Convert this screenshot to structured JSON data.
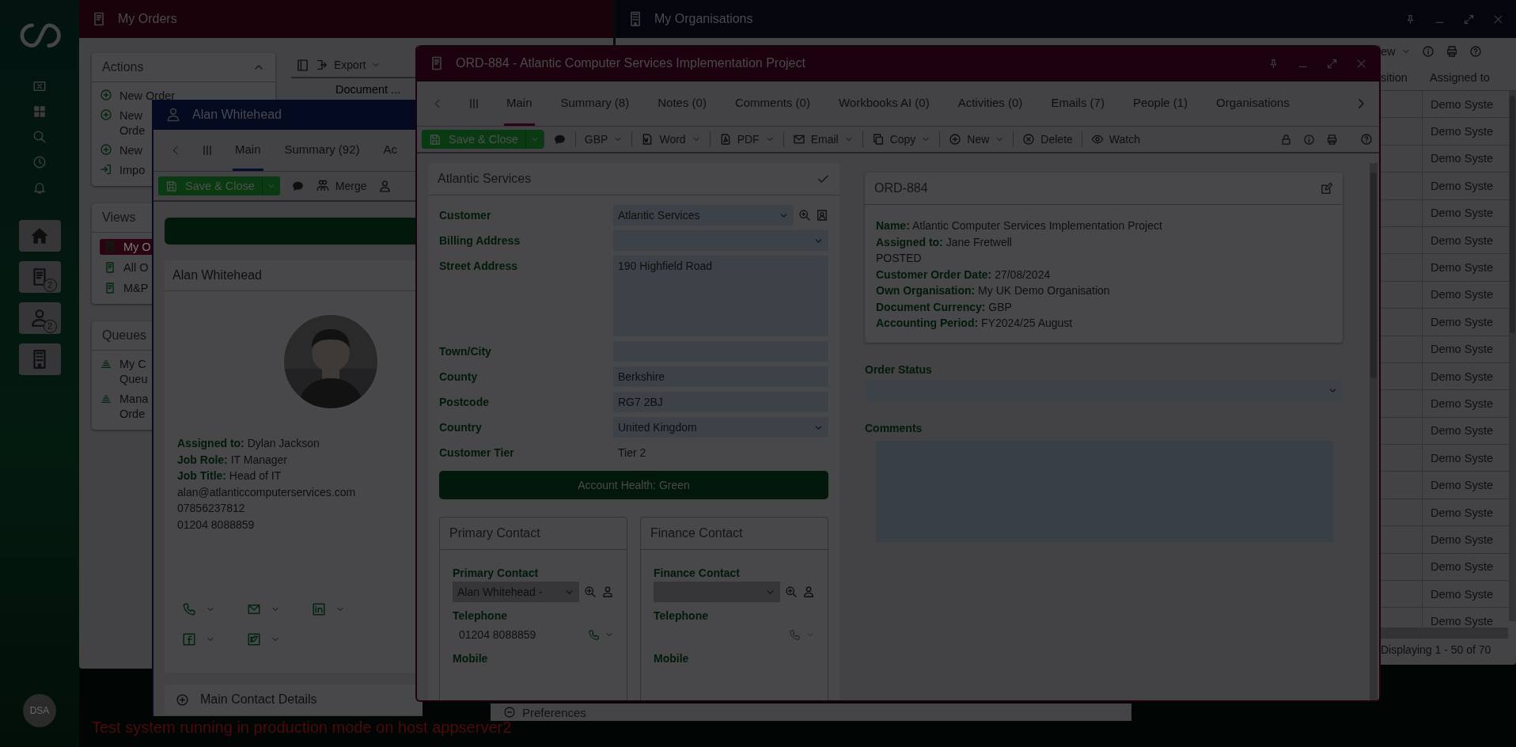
{
  "sidebar": {
    "shortcuts": [
      {
        "kind": "home"
      },
      {
        "kind": "orders",
        "badge": "2"
      },
      {
        "kind": "people",
        "badge": "2"
      },
      {
        "kind": "organisations"
      }
    ],
    "avatar": "DSA"
  },
  "my_orders": {
    "title": "My Orders",
    "export": "Export",
    "column": "Document ...",
    "actions": {
      "title": "Actions",
      "items": [
        {
          "kind": "new",
          "label": "New Order"
        },
        {
          "kind": "new",
          "label": "New\nOrde"
        },
        {
          "kind": "new",
          "label": "New"
        },
        {
          "kind": "import",
          "label": "Impo"
        }
      ]
    },
    "views": {
      "title": "Views",
      "items": [
        {
          "label": "My O",
          "selected": true
        },
        {
          "label": "All O",
          "selected": false
        },
        {
          "label": "M&P",
          "selected": false
        }
      ]
    },
    "queues": {
      "title": "Queues",
      "items": [
        {
          "label": "My C\nQueu"
        },
        {
          "label": "Mana\nOrde"
        }
      ]
    }
  },
  "my_organisations": {
    "title": "My Organisations",
    "view": "ew",
    "columns": [
      "sition",
      "Assigned to"
    ],
    "rows": [
      "Demo Syste",
      "Demo Syste",
      "Demo Syste",
      "Demo Syste",
      "Demo Syste",
      "Demo Syste",
      "Demo Syste",
      "Demo Syste",
      "Demo Syste",
      "Demo Syste",
      "Demo Syste",
      "Demo Syste",
      "Demo Syste",
      "Demo Syste",
      "Demo Syste",
      "Demo Syste",
      "Demo Syste",
      "Demo Syste",
      "Demo Syste",
      "Demo Syste"
    ],
    "footer": "Displaying 1 - 50 of 70"
  },
  "contact_window": {
    "title": "Alan Whitehead",
    "tabs": [
      {
        "label": "Main",
        "selected": true
      },
      {
        "label": "Summary (92)",
        "selected": false
      },
      {
        "label": "Ac",
        "selected": false
      }
    ],
    "save": "Save & Close",
    "merge": "Merge",
    "card": {
      "title": "Alan Whitehead",
      "details": [
        "**Assigned to:** Dylan Jackson",
        "**Job Role:** IT Manager",
        "**Job Title:** Head of IT",
        "alan@atlanticcomputerservices.com",
        "07856237812",
        "01204 8088859"
      ],
      "social": [
        {
          "kind": "phone"
        },
        {
          "kind": "email"
        },
        {
          "kind": "linkedin"
        },
        {
          "kind": "facebook"
        },
        {
          "kind": "twitter"
        }
      ]
    },
    "section": "Main Contact Details"
  },
  "order_window": {
    "title": "ORD-884 - Atlantic Computer Services Implementation Project",
    "tabs": [
      {
        "label": "Main",
        "selected": true
      },
      {
        "label": "Summary (8)",
        "selected": false
      },
      {
        "label": "Notes (0)",
        "selected": false
      },
      {
        "label": "Comments (0)",
        "selected": false
      },
      {
        "label": "Workbooks AI (0)",
        "selected": false
      },
      {
        "label": "Activities (0)",
        "selected": false
      },
      {
        "label": "Emails (7)",
        "selected": false
      },
      {
        "label": "People (1)",
        "selected": false
      },
      {
        "label": "Organisations",
        "selected": false
      }
    ],
    "save": "Save & Close",
    "toolbar": [
      {
        "kind": "comment"
      },
      {
        "kind": "currency",
        "label": "GBP",
        "dropdown": true
      },
      {
        "kind": "word",
        "label": "Word",
        "dropdown": true
      },
      {
        "kind": "pdf",
        "label": "PDF",
        "dropdown": true
      },
      {
        "kind": "email",
        "label": "Email",
        "dropdown": true
      },
      {
        "kind": "copy",
        "label": "Copy",
        "dropdown": true
      },
      {
        "kind": "new",
        "label": "New",
        "dropdown": true
      },
      {
        "kind": "delete",
        "label": "Delete",
        "dropdown": false
      },
      {
        "kind": "watch",
        "label": "Watch",
        "dropdown": false
      }
    ],
    "customer": {
      "title": "Atlantic Services",
      "fields": [
        {
          "label": "Customer",
          "value": "Atlantic Services",
          "kind": "lookup"
        },
        {
          "label": "Billing Address",
          "kind": "select"
        },
        {
          "label": "Street Address",
          "value": "190 Highfield Road",
          "kind": "textarea"
        },
        {
          "label": "Town/City",
          "kind": "text"
        },
        {
          "label": "County",
          "value": "Berkshire",
          "kind": "text"
        },
        {
          "label": "Postcode",
          "value": "RG7 2BJ",
          "kind": "text"
        },
        {
          "label": "Country",
          "value": "United Kingdom",
          "kind": "select"
        },
        {
          "label": "Customer Tier",
          "value": "Tier 2",
          "kind": "plain"
        }
      ],
      "health": "Account Health: Green"
    },
    "contacts": [
      {
        "title": "Primary Contact",
        "fields": [
          {
            "label": "Primary Contact",
            "value": "Alan Whitehead -",
            "kind": "lookup"
          },
          {
            "label": "Telephone",
            "value": "01204 8088859",
            "kind": "phone"
          },
          {
            "label": "Mobile",
            "kind": "label"
          }
        ]
      },
      {
        "title": "Finance Contact",
        "fields": [
          {
            "label": "Finance Contact",
            "kind": "lookup"
          },
          {
            "label": "Telephone",
            "kind": "phone"
          },
          {
            "label": "Mobile",
            "kind": "label"
          }
        ]
      }
    ],
    "summary": {
      "title": "ORD-884",
      "lines": [
        "**Name:** Atlantic Computer Services Implementation Project",
        "**Assigned to:** Jane Fretwell",
        "POSTED",
        "**Customer Order Date:** 27/08/2024",
        "**Own Organisation:** My UK Demo Organisation",
        "**Document Currency:** GBP",
        "**Accounting Period:** FY2024/25 August"
      ]
    },
    "order_status": "Order Status",
    "comments": "Comments"
  },
  "preferences": "Preferences",
  "banner": "Test system running in production mode on host appserver2"
}
